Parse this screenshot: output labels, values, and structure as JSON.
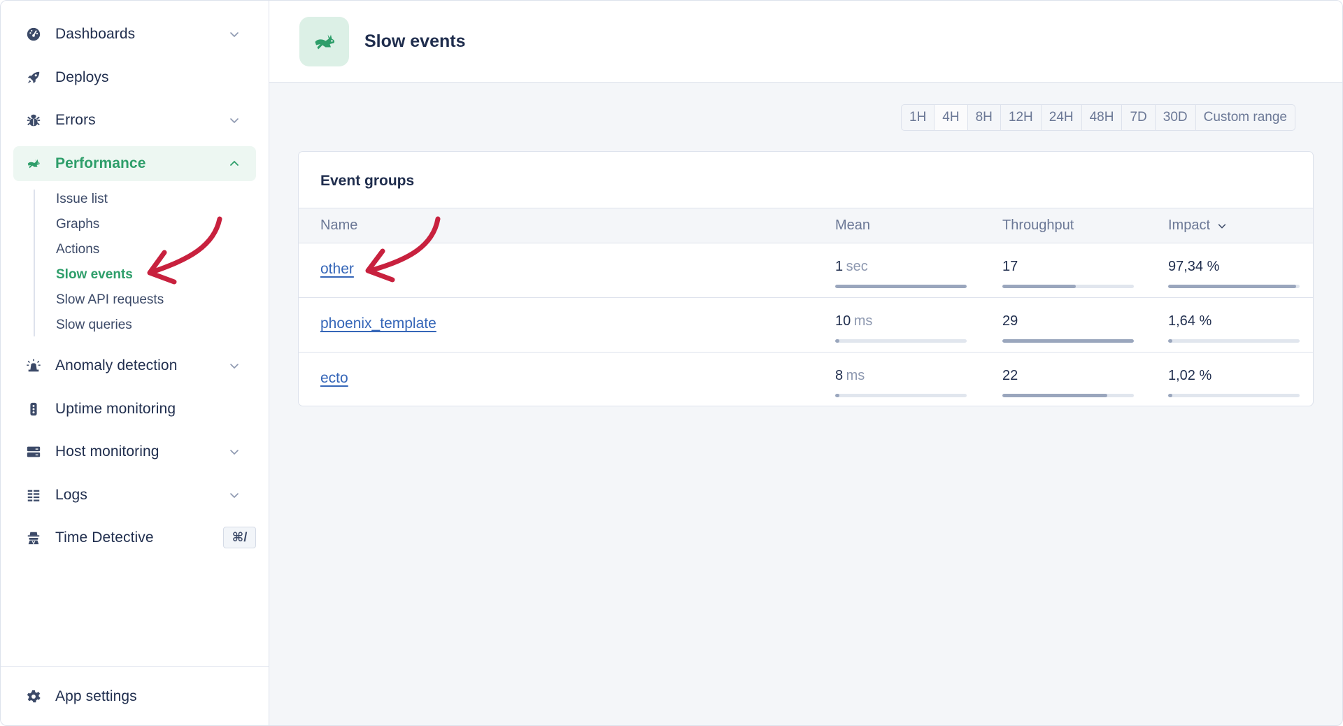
{
  "sidebar": {
    "items": [
      {
        "id": "dashboards",
        "label": "Dashboards",
        "icon": "dashboard-gauge-icon",
        "expandable": true
      },
      {
        "id": "deploys",
        "label": "Deploys",
        "icon": "rocket-icon",
        "expandable": false
      },
      {
        "id": "errors",
        "label": "Errors",
        "icon": "bug-icon",
        "expandable": true
      },
      {
        "id": "performance",
        "label": "Performance",
        "icon": "rabbit-icon",
        "expandable": true,
        "expanded": true,
        "active": true
      },
      {
        "id": "anomaly-detection",
        "label": "Anomaly detection",
        "icon": "siren-icon",
        "expandable": true
      },
      {
        "id": "uptime-monitoring",
        "label": "Uptime monitoring",
        "icon": "traffic-light-icon",
        "expandable": false
      },
      {
        "id": "host-monitoring",
        "label": "Host monitoring",
        "icon": "server-icon",
        "expandable": true
      },
      {
        "id": "logs",
        "label": "Logs",
        "icon": "list-icon",
        "expandable": true
      },
      {
        "id": "time-detective",
        "label": "Time Detective",
        "icon": "detective-icon",
        "shortcut": "⌘/"
      }
    ],
    "performance_submenu": [
      {
        "label": "Issue list"
      },
      {
        "label": "Graphs"
      },
      {
        "label": "Actions"
      },
      {
        "label": "Slow events",
        "active": true
      },
      {
        "label": "Slow API requests"
      },
      {
        "label": "Slow queries"
      }
    ],
    "footer": {
      "label": "App settings",
      "icon": "gear-icon"
    }
  },
  "header": {
    "title": "Slow events",
    "icon": "rabbit-icon"
  },
  "time_range": {
    "options": [
      "1H",
      "4H",
      "8H",
      "12H",
      "24H",
      "48H",
      "7D",
      "30D",
      "Custom range"
    ],
    "selected": "4H"
  },
  "event_groups": {
    "title": "Event groups",
    "columns": {
      "name": "Name",
      "mean": "Mean",
      "throughput": "Throughput",
      "impact": "Impact"
    },
    "sorted_by": "Impact",
    "rows": [
      {
        "name": "other",
        "mean_value": "1",
        "mean_unit": "sec",
        "mean_fraction": 1.0,
        "throughput": "17",
        "throughput_fraction": 0.56,
        "impact": "97,34 %",
        "impact_fraction": 0.9734
      },
      {
        "name": "phoenix_template",
        "mean_value": "10",
        "mean_unit": "ms",
        "mean_fraction": 0.02,
        "throughput": "29",
        "throughput_fraction": 1.0,
        "impact": "1,64 %",
        "impact_fraction": 0.0164
      },
      {
        "name": "ecto",
        "mean_value": "8",
        "mean_unit": "ms",
        "mean_fraction": 0.02,
        "throughput": "22",
        "throughput_fraction": 0.8,
        "impact": "1,02 %",
        "impact_fraction": 0.0102
      }
    ]
  },
  "colors": {
    "accent_green": "#2e9e6a",
    "link_blue": "#3566b8",
    "annotation_red": "#c8213e",
    "text_dark": "#1f2d4d"
  }
}
